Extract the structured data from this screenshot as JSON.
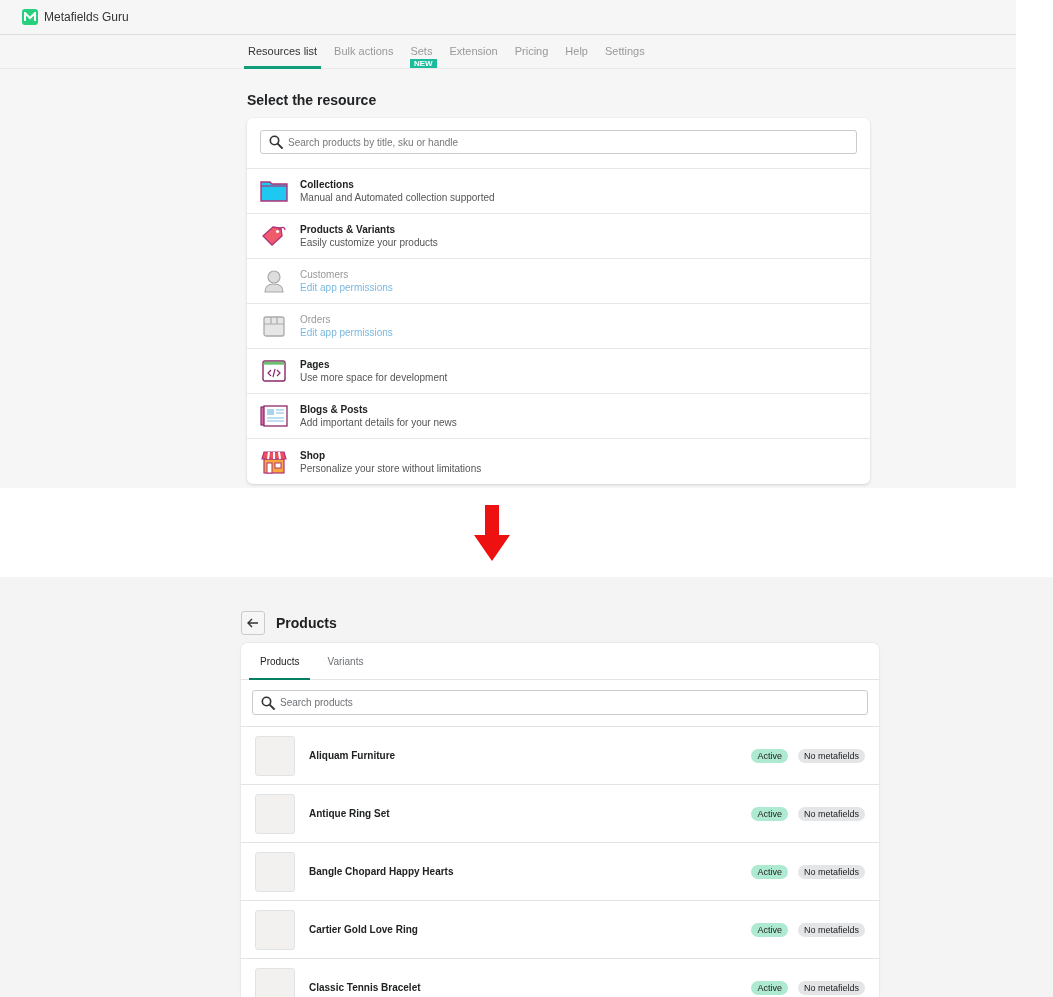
{
  "app": {
    "name": "Metafields Guru"
  },
  "nav_tabs": [
    {
      "label": "Resources list",
      "selected": true
    },
    {
      "label": "Bulk actions",
      "selected": false
    },
    {
      "label": "Sets",
      "selected": false,
      "badge": "NEW"
    },
    {
      "label": "Extension",
      "selected": false
    },
    {
      "label": "Pricing",
      "selected": false
    },
    {
      "label": "Help",
      "selected": false
    },
    {
      "label": "Settings",
      "selected": false
    }
  ],
  "heading": "Select the resource",
  "resource_search": {
    "placeholder": "Search products by title, sku or handle"
  },
  "resources": [
    {
      "kind": "collection",
      "title": "Collections",
      "subtitle": "Manual and Automated collection supported",
      "disabled": false
    },
    {
      "kind": "product",
      "title": "Products & Variants",
      "subtitle": "Easily customize your products",
      "disabled": false
    },
    {
      "kind": "customer",
      "title": "Customers",
      "subtitle": "Edit app permissions",
      "disabled": true
    },
    {
      "kind": "order",
      "title": "Orders",
      "subtitle": "Edit app permissions",
      "disabled": true
    },
    {
      "kind": "page",
      "title": "Pages",
      "subtitle": "Use more space for development",
      "disabled": false
    },
    {
      "kind": "blog",
      "title": "Blogs & Posts",
      "subtitle": "Add important details for your news",
      "disabled": false
    },
    {
      "kind": "shop",
      "title": "Shop",
      "subtitle": "Personalize your store without limitations",
      "disabled": false
    }
  ],
  "products_page": {
    "title": "Products",
    "tabs": [
      {
        "label": "Products",
        "selected": true
      },
      {
        "label": "Variants",
        "selected": false
      }
    ],
    "search": {
      "placeholder": "Search products"
    },
    "products": [
      {
        "name": "Aliquam Furniture",
        "status": "Active",
        "metafields": "No metafields"
      },
      {
        "name": "Antique Ring Set",
        "status": "Active",
        "metafields": "No metafields"
      },
      {
        "name": "Bangle Chopard Happy Hearts",
        "status": "Active",
        "metafields": "No metafields"
      },
      {
        "name": "Cartier Gold Love Ring",
        "status": "Active",
        "metafields": "No metafields"
      },
      {
        "name": "Classic Tennis Bracelet",
        "status": "Active",
        "metafields": "No metafields"
      }
    ]
  }
}
